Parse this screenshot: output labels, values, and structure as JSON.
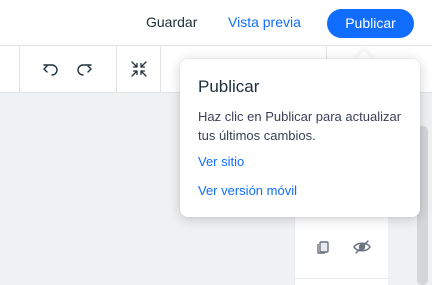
{
  "header": {
    "save_label": "Guardar",
    "preview_label": "Vista previa",
    "publish_label": "Publicar"
  },
  "toolbar": {
    "undo_icon": "undo-icon",
    "redo_icon": "redo-icon",
    "zoom_out_icon": "zoom-out-icon"
  },
  "popover": {
    "title": "Publicar",
    "description": "Haz clic en Publicar para actualizar tus últimos cambios.",
    "link_view_site": "Ver sitio",
    "link_view_mobile": "Ver versión móvil"
  },
  "side_panel": {
    "duplicate_icon": "duplicate-icon",
    "hide_icon": "hide-icon"
  },
  "colors": {
    "accent": "#116dff",
    "text": "#20303c",
    "canvas": "#f0f1f3"
  }
}
